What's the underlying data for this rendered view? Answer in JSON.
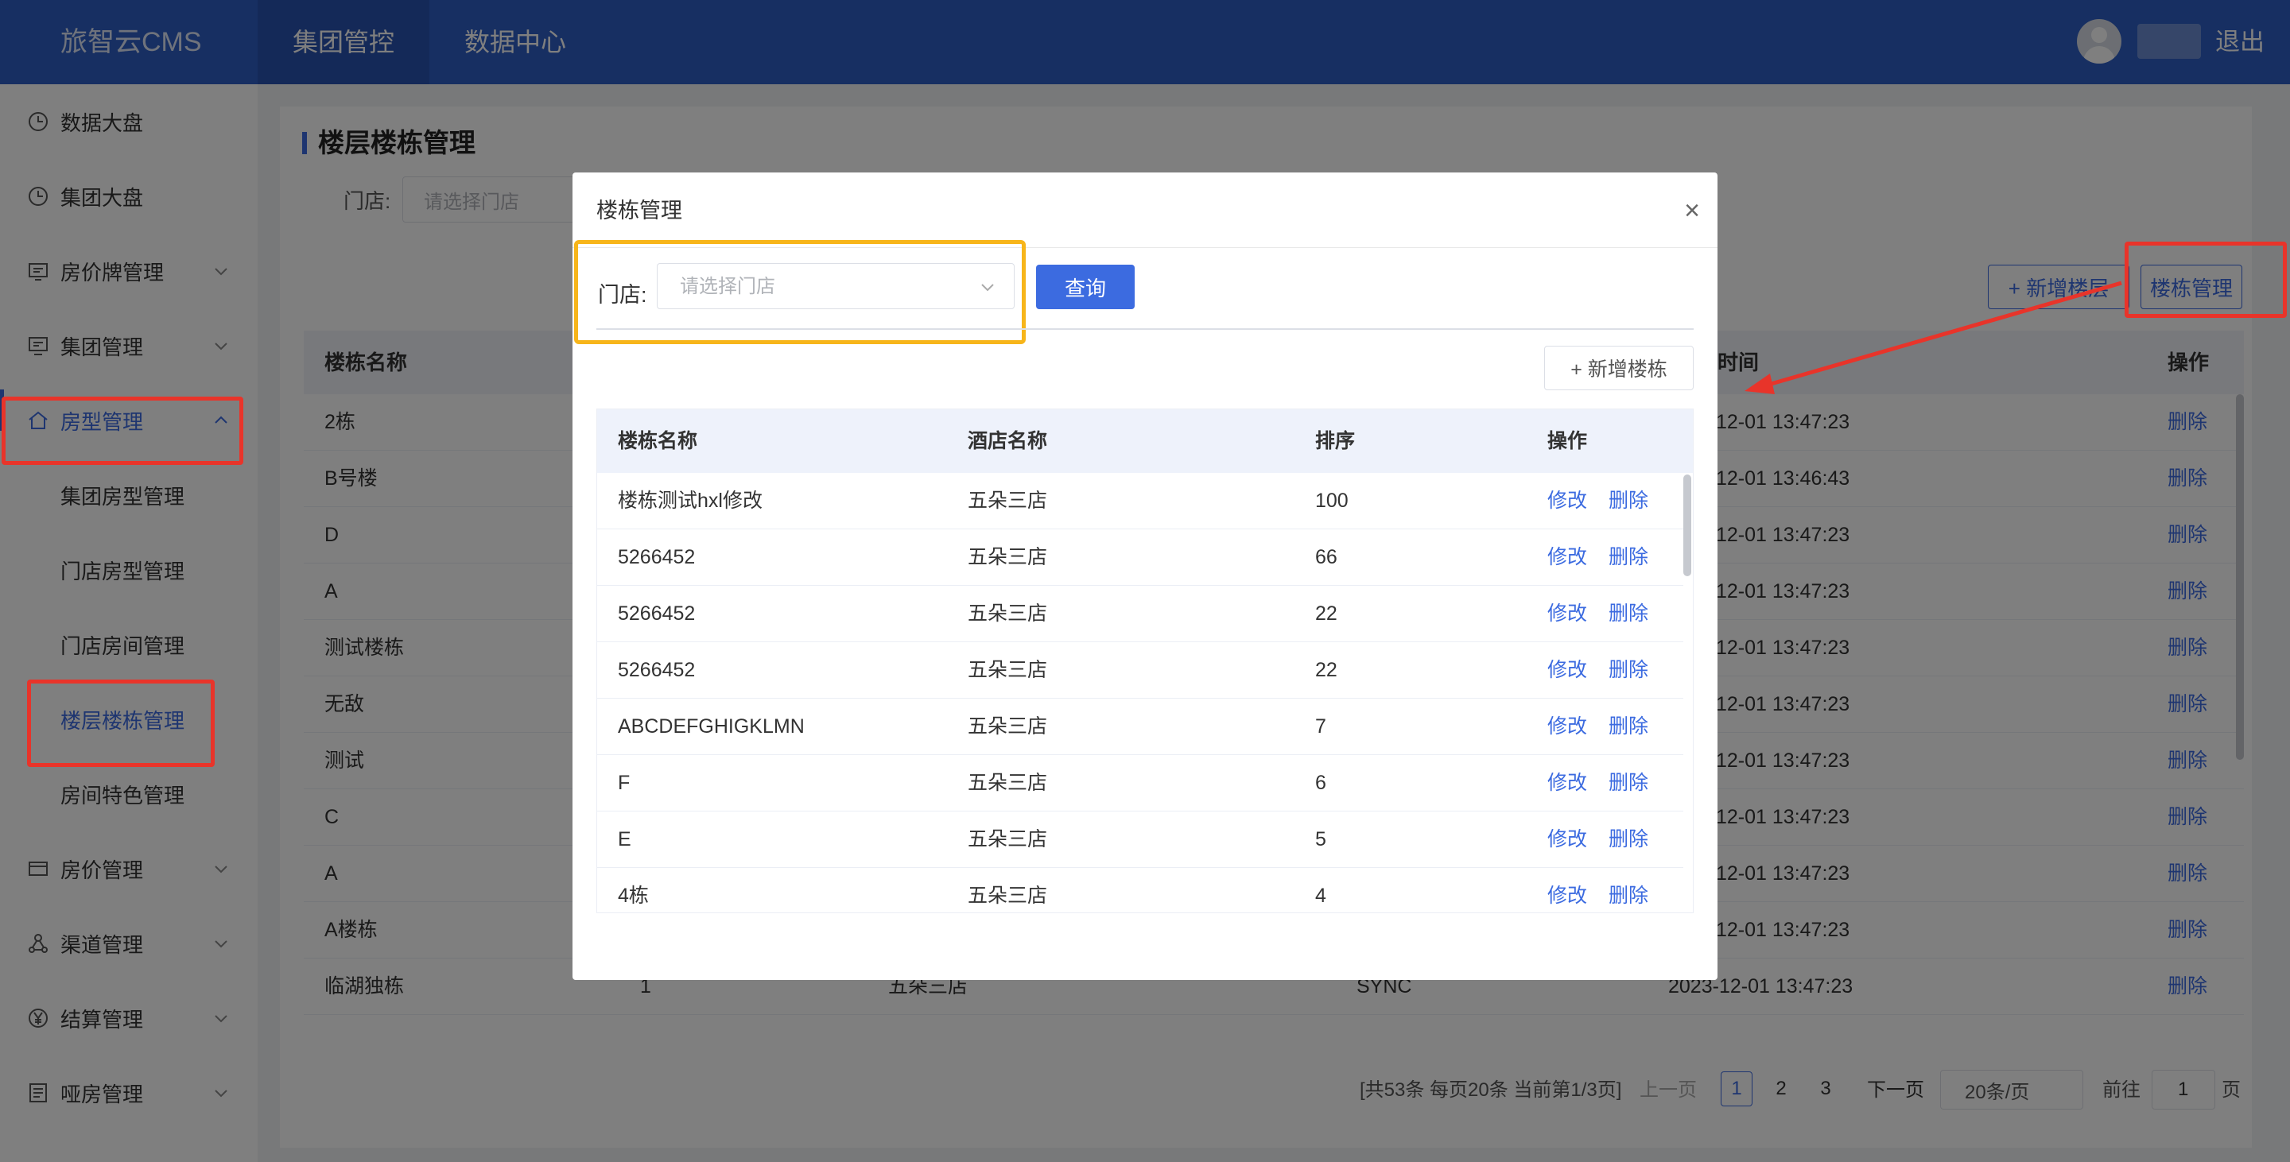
{
  "header": {
    "logo": "旅智云CMS",
    "tabs": [
      {
        "label": "集团管控"
      },
      {
        "label": "数据中心"
      }
    ],
    "logout": "退出"
  },
  "sidebar": {
    "items": [
      {
        "label": "数据大盘",
        "icon": "clock-icon"
      },
      {
        "label": "集团大盘",
        "icon": "clock-icon"
      },
      {
        "label": "房价牌管理",
        "icon": "board-icon"
      },
      {
        "label": "集团管理",
        "icon": "monitor-icon"
      },
      {
        "label": "房型管理",
        "icon": "home-icon"
      },
      {
        "label": "集团房型管理"
      },
      {
        "label": "门店房型管理"
      },
      {
        "label": "门店房间管理"
      },
      {
        "label": "楼层楼栋管理"
      },
      {
        "label": "房间特色管理"
      },
      {
        "label": "房价管理",
        "icon": "card-icon"
      },
      {
        "label": "渠道管理",
        "icon": "network-icon"
      },
      {
        "label": "结算管理",
        "icon": "yen-icon"
      },
      {
        "label": "哑房管理",
        "icon": "list-icon"
      }
    ]
  },
  "page": {
    "title": "楼层楼栋管理",
    "store_label": "门店:",
    "store_placeholder": "请选择门店",
    "add_floor": "+ 新增楼层",
    "building_mgmt": "楼栋管理",
    "table": {
      "headers": [
        "楼栋名称",
        "时间",
        "操作"
      ],
      "rows": [
        {
          "name": "2栋",
          "time": "12-01 13:47:23",
          "op": "删除"
        },
        {
          "name": "B号楼",
          "time": "12-01 13:46:43",
          "op": "删除"
        },
        {
          "name": "D",
          "time": "12-01 13:47:23",
          "op": "删除"
        },
        {
          "name": "A",
          "time": "12-01 13:47:23",
          "op": "删除"
        },
        {
          "name": "测试楼栋",
          "time": "12-01 13:47:23",
          "op": "删除"
        },
        {
          "name": "无敌",
          "time": "12-01 13:47:23",
          "op": "删除"
        },
        {
          "name": "测试",
          "time": "12-01 13:47:23",
          "op": "删除"
        },
        {
          "name": "C",
          "time": "12-01 13:47:23",
          "op": "删除"
        },
        {
          "name": "A",
          "time": "12-01 13:47:23",
          "op": "删除"
        },
        {
          "name": "A楼栋",
          "time": "12-01 13:47:23",
          "op": "删除"
        },
        {
          "name": "临湖独栋",
          "col2": "1",
          "col3": "五朵三店",
          "col4": "SYNC",
          "time": "2023-12-01 13:47:23",
          "op": "删除"
        }
      ]
    },
    "pagination": {
      "summary": "[共53条 每页20条 当前第1/3页]",
      "prev": "上一页",
      "pages": [
        "1",
        "2",
        "3"
      ],
      "next": "下一页",
      "page_size": "20条/页",
      "goto_label": "前往",
      "goto_value": "1",
      "page_unit": "页"
    }
  },
  "modal": {
    "title": "楼栋管理",
    "close": "×",
    "store_label": "门店:",
    "store_placeholder": "请选择门店",
    "query": "查询",
    "add_building": "+ 新增楼栋",
    "headers": [
      "楼栋名称",
      "酒店名称",
      "排序",
      "操作"
    ],
    "rows": [
      {
        "name": "楼栋测试hxl修改",
        "hotel": "五朵三店",
        "sort": "100",
        "edit": "修改",
        "del": "删除"
      },
      {
        "name": "5266452",
        "hotel": "五朵三店",
        "sort": "66",
        "edit": "修改",
        "del": "删除"
      },
      {
        "name": "5266452",
        "hotel": "五朵三店",
        "sort": "22",
        "edit": "修改",
        "del": "删除"
      },
      {
        "name": "5266452",
        "hotel": "五朵三店",
        "sort": "22",
        "edit": "修改",
        "del": "删除"
      },
      {
        "name": "ABCDEFGHIGKLMN",
        "hotel": "五朵三店",
        "sort": "7",
        "edit": "修改",
        "del": "删除"
      },
      {
        "name": "F",
        "hotel": "五朵三店",
        "sort": "6",
        "edit": "修改",
        "del": "删除"
      },
      {
        "name": "E",
        "hotel": "五朵三店",
        "sort": "5",
        "edit": "修改",
        "del": "删除"
      },
      {
        "name": "4栋",
        "hotel": "五朵三店",
        "sort": "4",
        "edit": "修改",
        "del": "删除"
      }
    ]
  },
  "colors": {
    "primary": "#3c6be0",
    "header": "#2f5ec4",
    "highlight_red": "#e8342a",
    "highlight_yellow": "#f7b51a"
  }
}
